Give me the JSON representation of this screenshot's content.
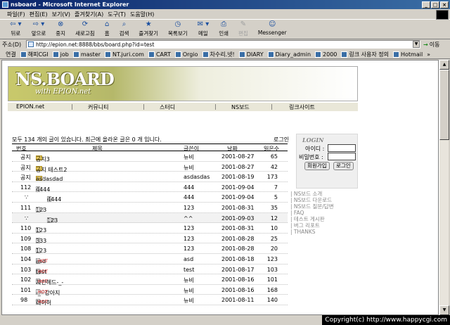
{
  "window": {
    "title": "nsboard - Microsoft Internet Explorer",
    "btn_min": "_",
    "btn_max": "□",
    "btn_close": "×"
  },
  "menu": [
    "파일(F)",
    "편집(E)",
    "보기(V)",
    "즐겨찾기(A)",
    "도구(T)",
    "도움말(H)"
  ],
  "toolbar": [
    {
      "label": "뒤로",
      "icon": "⇦ ▾"
    },
    {
      "label": "앞으로",
      "icon": "⇨ ▾"
    },
    {
      "label": "중지",
      "icon": "⊗"
    },
    {
      "label": "새로고침",
      "icon": "⟳"
    },
    {
      "label": "홈",
      "icon": "⌂"
    },
    {
      "label": "검색",
      "icon": "⌕"
    },
    {
      "label": "즐겨찾기",
      "icon": "★"
    },
    {
      "label": "목록보기",
      "icon": "◷"
    },
    {
      "label": "메일",
      "icon": "✉ ▾"
    },
    {
      "label": "인쇄",
      "icon": "⎙"
    },
    {
      "label": "편집",
      "icon": "✎"
    },
    {
      "label": "Messenger",
      "icon": "☺"
    }
  ],
  "address": {
    "label": "주소(D)",
    "url": "http://epion.net:8888/bbs/board.php?id=test",
    "go_label": "이동",
    "go_icon": "→"
  },
  "links": {
    "label": "연결",
    "items": [
      "해피CGI",
      "job",
      "master",
      "NT.juri.com",
      "CART",
      "Orgio",
      "차수리.넷!",
      "DIARY",
      "Diary_admin",
      "2000",
      "링크 사용자 정의",
      "Hotmail"
    ],
    "more": "»"
  },
  "logo": {
    "main": "NS.BOARD",
    "sub": "with EPION.net"
  },
  "nav": [
    "EPION.net",
    "커뮤니티",
    "스터디",
    "NS보드",
    "링크사이트"
  ],
  "nav_sep": "|",
  "board": {
    "total_text": "모두 134 개의 글이 있습니다. 최근에 올라온 글은 0 개 입니다.",
    "login_link": "로그인",
    "headers": [
      "번호",
      "제목",
      "글쓴이",
      "날짜",
      "읽은수"
    ],
    "rows": [
      {
        "no": "공지",
        "title": "공지3",
        "count": "",
        "hot": "",
        "author": "뉴비",
        "date": "2001-08-27",
        "reads": "65",
        "icon": "folder",
        "indent": 0,
        "shade": false
      },
      {
        "no": "공지",
        "title": "공지 테스트2",
        "count": "",
        "hot": "",
        "author": "뉴비",
        "date": "2001-08-27",
        "reads": "42",
        "icon": "folder",
        "indent": 0,
        "shade": false
      },
      {
        "no": "공지",
        "title": "asdasdad",
        "count": "[2]",
        "hot": "",
        "author": "asdasdas",
        "date": "2001-08-19",
        "reads": "173",
        "icon": "folder",
        "indent": 0,
        "shade": false
      },
      {
        "no": "112",
        "title": "4444",
        "count": "",
        "hot": "",
        "author": "444",
        "date": "2001-09-04",
        "reads": "7",
        "icon": "doc",
        "indent": 0,
        "shade": false
      },
      {
        "no": "∵",
        "title": "4444",
        "count": "",
        "hot": "",
        "author": "444",
        "date": "2001-09-04",
        "reads": "5",
        "icon": "doc",
        "indent": 1,
        "shade": false
      },
      {
        "no": "111",
        "title": "123",
        "count": "[1]",
        "hot": "",
        "author": "123",
        "date": "2001-08-31",
        "reads": "35",
        "icon": "doc",
        "indent": 0,
        "shade": false
      },
      {
        "no": "∵",
        "title": "123",
        "count": "[2]",
        "hot": "",
        "author": "^^",
        "date": "2001-09-03",
        "reads": "12",
        "icon": "doc",
        "indent": 1,
        "shade": true
      },
      {
        "no": "110",
        "title": "123",
        "count": "",
        "hot": "",
        "author": "123",
        "date": "2001-08-31",
        "reads": "10",
        "icon": "doc",
        "indent": 0,
        "shade": false
      },
      {
        "no": "109",
        "title": "333",
        "count": "",
        "hot": "",
        "author": "123",
        "date": "2001-08-28",
        "reads": "25",
        "icon": "doc",
        "indent": 0,
        "shade": false
      },
      {
        "no": "108",
        "title": "123",
        "count": "",
        "hot": "",
        "author": "123",
        "date": "2001-08-28",
        "reads": "20",
        "icon": "doc",
        "indent": 0,
        "shade": false
      },
      {
        "no": "104",
        "title": "asd",
        "count": "",
        "hot": "HOT",
        "author": "asd",
        "date": "2001-08-18",
        "reads": "123",
        "icon": "doc",
        "indent": 0,
        "shade": false
      },
      {
        "no": "103",
        "title": "test",
        "count": "[3]",
        "hot": "HOT",
        "author": "test",
        "date": "2001-08-17",
        "reads": "103",
        "icon": "doc",
        "indent": 0,
        "shade": false
      },
      {
        "no": "102",
        "title": "치킨헤드-_-",
        "count": "",
        "hot": "HOT",
        "author": "뉴비",
        "date": "2001-08-16",
        "reads": "101",
        "icon": "doc",
        "indent": 0,
        "shade": false
      },
      {
        "no": "101",
        "title": "-_- 강아지",
        "count": "[2]",
        "hot": "HOT",
        "author": "뉴비",
        "date": "2001-08-16",
        "reads": "168",
        "icon": "doc",
        "indent": 0,
        "shade": false
      },
      {
        "no": "98",
        "title": "허허허",
        "count": "",
        "hot": "HOT",
        "author": "뉴비",
        "date": "2001-08-11",
        "reads": "140",
        "icon": "doc",
        "indent": 0,
        "shade": false
      }
    ]
  },
  "login": {
    "title": "LOGIN",
    "id_label": "아이디 :",
    "pw_label": "비밀번호 :",
    "join": "회원가입",
    "login": "로그인"
  },
  "sidelinks": [
    "| NS보드 소개",
    "| NS보드 다운로드",
    "| NS보드 질문/답변",
    "| FAQ",
    "| 테스트 게시판",
    "| 버그 리포트",
    "| THANKS"
  ],
  "status": {
    "copyright": "Copyright(c) http://www.happycgi.com"
  }
}
